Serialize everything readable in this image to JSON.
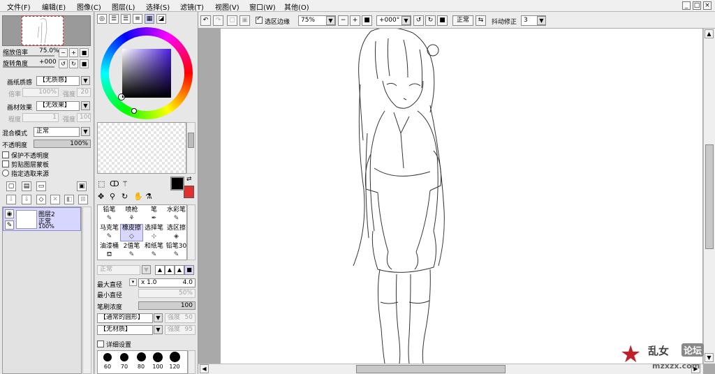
{
  "menu": [
    "文件(F)",
    "编辑(E)",
    "图像(C)",
    "图层(L)",
    "选择(S)",
    "滤镜(T)",
    "视图(V)",
    "窗口(W)",
    "其他(O)"
  ],
  "window": {
    "minimize": "_",
    "restore": "□",
    "close": "×"
  },
  "navigator": {
    "zoom_label": "缩放倍率",
    "zoom_value": "75.0%",
    "rotate_label": "旋转角度",
    "rotate_value": "+000"
  },
  "paper": {
    "texture_label": "画纸质感",
    "texture_value": "【无质感】",
    "texture_ratio_label": "倍率",
    "texture_ratio_value": "100%",
    "texture_strength_label": "强度",
    "texture_strength_value": "20",
    "effect_label": "画材效果",
    "effect_value": "【无效果】",
    "effect_degree_label": "程度",
    "effect_degree_value": "1",
    "effect_strength_label": "强度",
    "effect_strength_value": "100"
  },
  "layer_props": {
    "blend_label": "混合模式",
    "blend_value": "正常",
    "opacity_label": "不透明度",
    "opacity_value": "100%",
    "opacity_fraction": 1.0,
    "check_protect": "保护不透明度",
    "check_clip": "剪贴图层蒙板",
    "check_source": "指定选取来源"
  },
  "layer": {
    "name": "图层2",
    "mode": "正常",
    "opacity": "100%"
  },
  "tools": [
    {
      "label": "铅笔",
      "icon": "pencil-icon",
      "glyph": "✎"
    },
    {
      "label": "喷枪",
      "icon": "airbrush-icon",
      "glyph": "⚘"
    },
    {
      "label": "笔",
      "icon": "pen-icon",
      "glyph": "✒"
    },
    {
      "label": "水彩笔",
      "icon": "watercolor-icon",
      "glyph": "✎"
    },
    {
      "label": "马克笔",
      "icon": "marker-icon",
      "glyph": "✎"
    },
    {
      "label": "橡皮擦",
      "icon": "eraser-icon",
      "glyph": "◇"
    },
    {
      "label": "选择笔",
      "icon": "select-pen-icon",
      "glyph": "⊹"
    },
    {
      "label": "选区擦",
      "icon": "select-eraser-icon",
      "glyph": "◈"
    },
    {
      "label": "油漆桶",
      "icon": "bucket-icon",
      "glyph": "⛾"
    },
    {
      "label": "2值笔",
      "icon": "binary-pen-icon",
      "glyph": "✎"
    },
    {
      "label": "和纸笔",
      "icon": "washi-pen-icon",
      "glyph": "✎"
    },
    {
      "label": "铅笔30",
      "icon": "pencil30-icon",
      "glyph": "✎"
    }
  ],
  "brush": {
    "mode_value": "正常",
    "max_size_label": "最大直径",
    "max_size_mult": "x 1.0",
    "max_size_value": "4.0",
    "min_size_label": "最小直径",
    "min_size_value": "50%",
    "density_label": "笔刷浓度",
    "density_value": "100",
    "density_fraction": 1.0,
    "shape_value": "【通常的圆形】",
    "shape_strength_label": "强度",
    "shape_strength_value": "50",
    "texture_value": "【无材质】",
    "texture_strength_label": "强度",
    "texture_strength_value": "95",
    "detail_label": "详细设置",
    "sizes": [
      "60",
      "70",
      "80",
      "100",
      "120"
    ]
  },
  "toolbar": {
    "sel_edge_label": "选区边缘",
    "zoom_value": "75%",
    "rotate_value": "+000°",
    "mode_value": "正常",
    "stabilizer_label": "抖动修正",
    "stabilizer_value": "3"
  },
  "watermark": {
    "site": "乱女",
    "forum": "论坛",
    "url": "mzxzx.com"
  },
  "colors": {
    "primary": "#000000",
    "secondary": "#e03030"
  }
}
